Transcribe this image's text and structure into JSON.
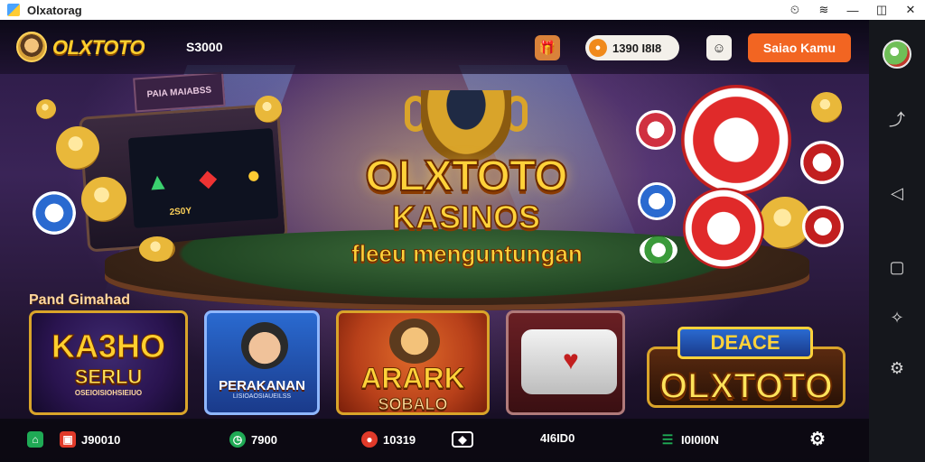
{
  "window": {
    "title": "Olxatorag",
    "buttons": [
      "⏲",
      "≋",
      "—",
      "◫",
      "✕"
    ]
  },
  "header": {
    "logo_text": "OLXTOTO",
    "balance": "S3000",
    "coins": "1390 I8I8",
    "cta_label": "Saiao Kamu"
  },
  "hero": {
    "title": "OLXTOTO",
    "subtitle": "KASINOS",
    "tagline": "fleeu menguntungan",
    "slot_sign": "PAIA MAIABSS",
    "slot_label": "2S0Y"
  },
  "section": {
    "label": "Pand Gimahad"
  },
  "games": [
    {
      "title": "KA3HO",
      "subtitle": "SERLU",
      "small": "OSEIOISIOHSIEIUO"
    },
    {
      "title": "PERAKANAN",
      "small": "LISIOAOSIAUEILSS"
    },
    {
      "title": "ARARK",
      "subtitle": "SOBALO"
    },
    {
      "title": ""
    },
    {
      "badge": "DEACE",
      "title": "OLXTOTO"
    }
  ],
  "bottom": [
    {
      "icon": "home-icon",
      "value": ""
    },
    {
      "icon": "wallet-icon",
      "value": "J90010"
    },
    {
      "icon": "clock-icon",
      "value": "7900"
    },
    {
      "icon": "record-icon",
      "value": "10319"
    },
    {
      "icon": "card-icon",
      "value": ""
    },
    {
      "icon": "text",
      "value": "4I6ID0"
    },
    {
      "icon": "list-icon",
      "value": "I0I0I0N"
    },
    {
      "icon": "gear-icon",
      "value": ""
    }
  ],
  "colors": {
    "accent": "#f26522",
    "gold": "#ffd23a",
    "sidebar": "#15171c"
  }
}
